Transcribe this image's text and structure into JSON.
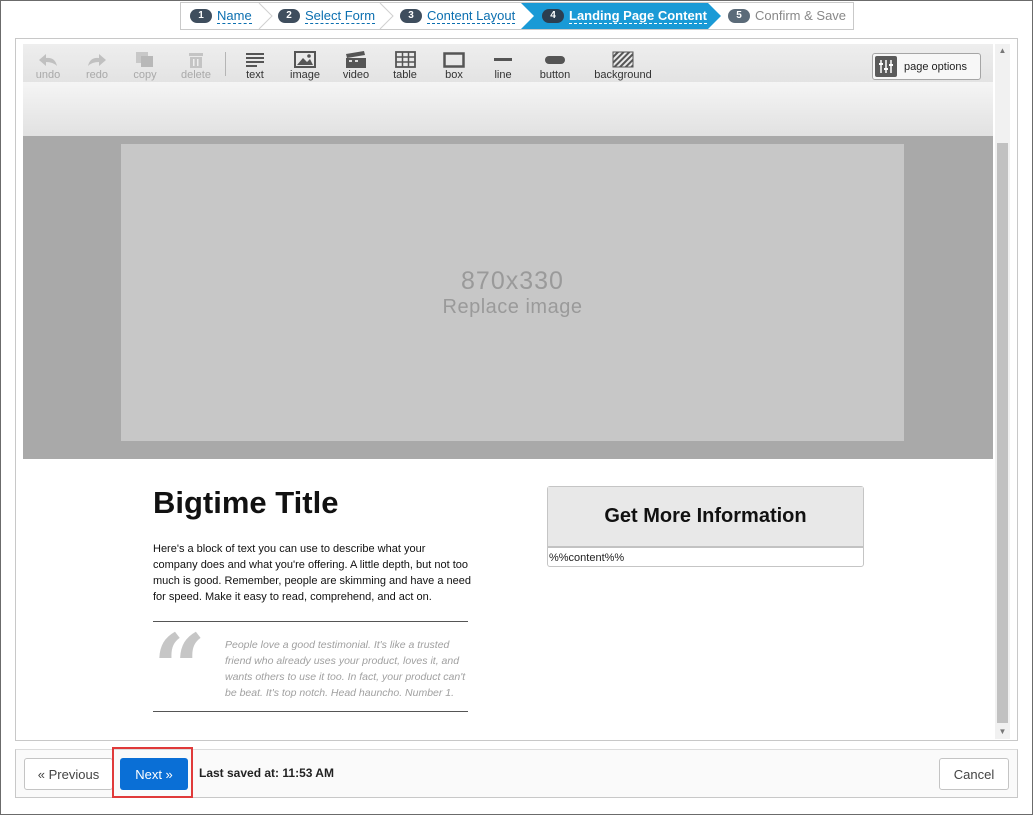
{
  "wizard": {
    "steps": [
      {
        "num": "1",
        "label": "Name"
      },
      {
        "num": "2",
        "label": "Select Form"
      },
      {
        "num": "3",
        "label": "Content Layout"
      },
      {
        "num": "4",
        "label": "Landing Page Content"
      },
      {
        "num": "5",
        "label": "Confirm & Save"
      }
    ],
    "active_step": "4"
  },
  "toolbar": {
    "undo": "undo",
    "redo": "redo",
    "copy": "copy",
    "delete": "delete",
    "text": "text",
    "image": "image",
    "video": "video",
    "table": "table",
    "box": "box",
    "line": "line",
    "button": "button",
    "background": "background",
    "page_options": "page options"
  },
  "canvas": {
    "placeholder_size": "870x330",
    "placeholder_action": "Replace image",
    "title": "Bigtime Title",
    "body": "Here's a block of text you can use to describe what your company does and what you're offering. A little depth, but not too much is good. Remember, people are skimming and have a need for speed. Make it easy to read, comprehend, and act on.",
    "quote_mark": "“",
    "testimonial": "People love a good testimonial. It's like a trusted friend who already uses your product, loves it, and wants others to use it too. In fact, your product can't be beat. It's top notch. Head hauncho. Number 1.",
    "cta_label": "Get More Information",
    "cta_content": "%%content%%"
  },
  "footer": {
    "previous": "« Previous",
    "next": "Next »",
    "saved_prefix": "Last saved at:",
    "saved_time": "11:53 AM",
    "cancel": "Cancel"
  },
  "colors": {
    "accent": "#1a9ad6",
    "primary_button": "#0a6fd6",
    "highlight": "#e03a3a",
    "link": "#0b6fb0"
  }
}
